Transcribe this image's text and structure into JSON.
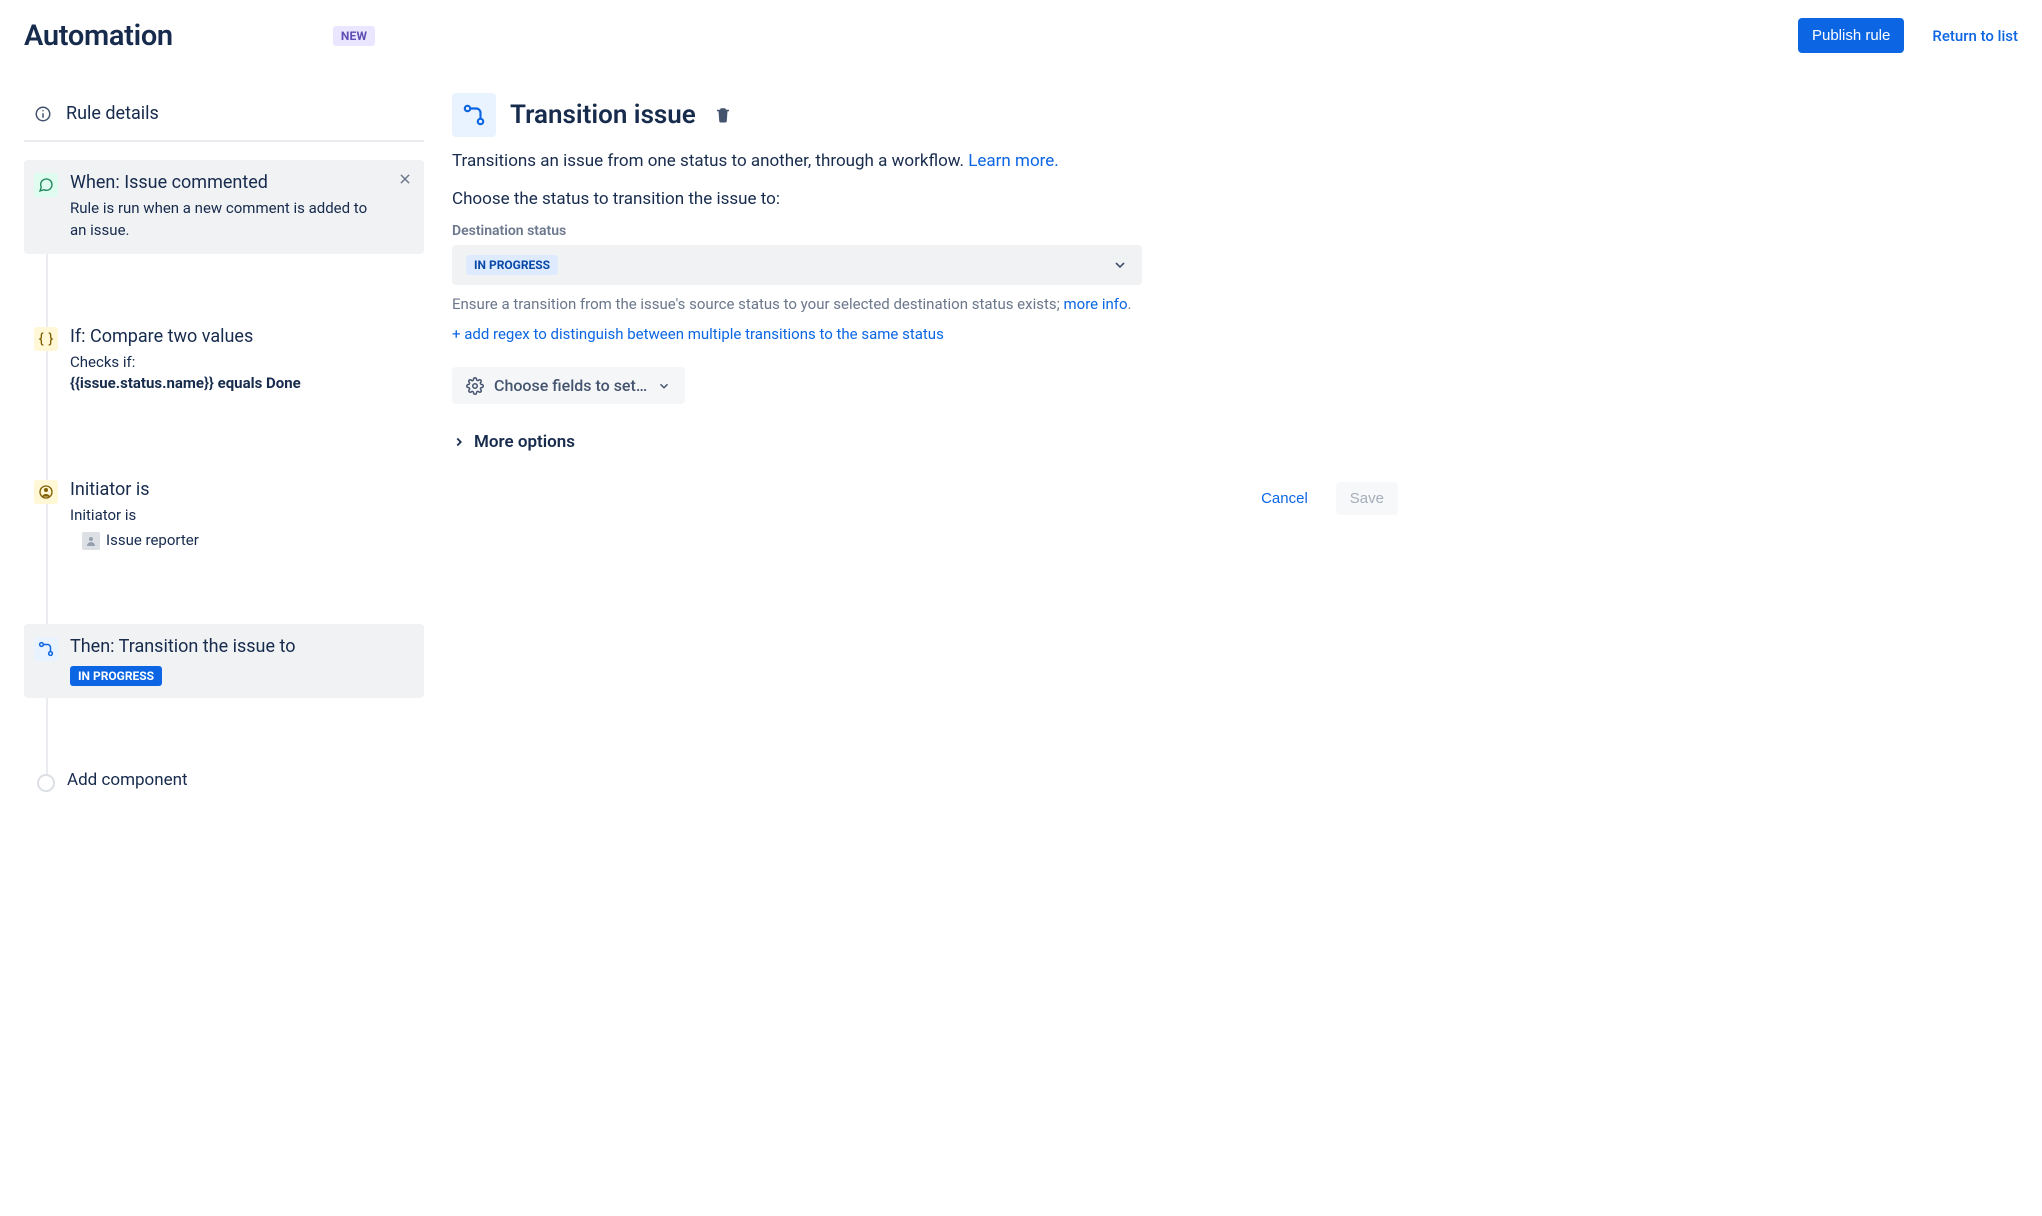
{
  "header": {
    "title": "Automation",
    "badge": "NEW",
    "publish_label": "Publish rule",
    "return_label": "Return to list"
  },
  "sidebar": {
    "rule_details_label": "Rule details",
    "items": [
      {
        "title": "When: Issue commented",
        "desc": "Rule is run when a new comment is added to an issue."
      },
      {
        "title": "If: Compare two values",
        "desc_prefix": "Checks if:",
        "desc_bold": "{{issue.status.name}} equals Done"
      },
      {
        "title": "Initiator is",
        "desc_prefix": "Initiator is",
        "reporter_label": "Issue reporter"
      },
      {
        "title": "Then: Transition the issue to",
        "status_badge": "IN PROGRESS"
      }
    ],
    "add_component_label": "Add component"
  },
  "panel": {
    "title": "Transition issue",
    "description_text": "Transitions an issue from one status to another, through a workflow. ",
    "learn_more": "Learn more.",
    "choose_status_label": "Choose the status to transition the issue to:",
    "dest_status_label": "Destination status",
    "dest_status_value": "IN PROGRESS",
    "ensure_text": "Ensure a transition from the issue's source status to your selected destination status exists; ",
    "more_info": "more info",
    "add_regex": "+ add regex to distinguish between multiple transitions to the same status",
    "choose_fields": "Choose fields to set…",
    "more_options": "More options",
    "cancel": "Cancel",
    "save": "Save"
  }
}
